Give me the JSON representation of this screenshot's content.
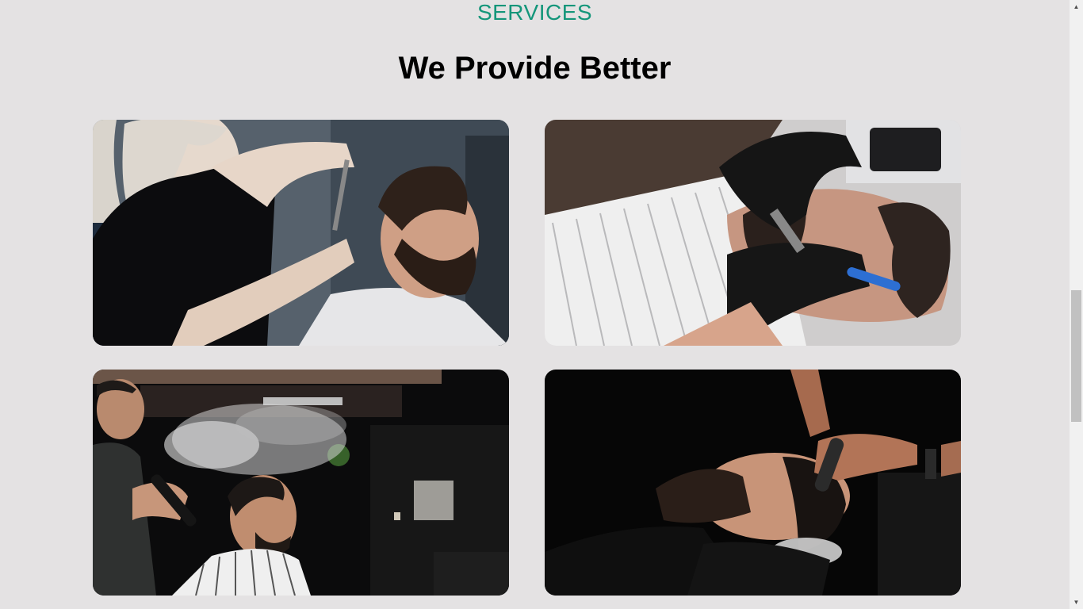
{
  "services": {
    "eyebrow": "SERVICES",
    "heading": "We Provide Better",
    "cards": [
      {
        "image": "haircut-with-scissors"
      },
      {
        "image": "beard-shave-with-razor"
      },
      {
        "image": "hair-spray-styling"
      },
      {
        "image": "hair-wash"
      }
    ]
  },
  "colors": {
    "accent": "#14967a",
    "background": "#e4e2e3"
  },
  "scrollbar": {
    "up_icon": "scroll-up-arrow-icon",
    "down_icon": "scroll-down-arrow-icon"
  }
}
